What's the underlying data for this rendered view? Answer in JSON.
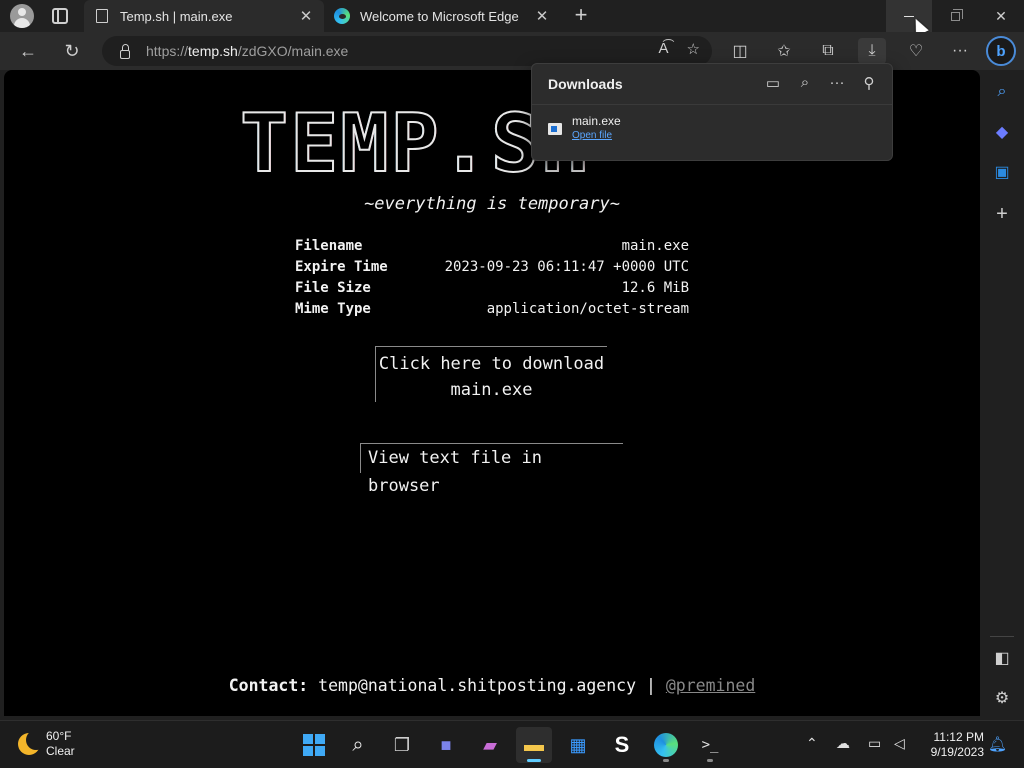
{
  "browser": {
    "tabs": [
      {
        "title": "Temp.sh | main.exe",
        "active": true
      },
      {
        "title": "Welcome to Microsoft Edge",
        "active": false
      }
    ],
    "url": {
      "scheme": "https://",
      "host": "temp.sh",
      "path": "/zdGXO/main.exe"
    },
    "icons": {
      "back": "arrow-left-icon",
      "refresh": "refresh-icon",
      "lock": "lock-icon",
      "read_aloud": "read-aloud-icon",
      "favorite": "star-icon",
      "split": "split-screen-icon",
      "favorites": "favorites-icon",
      "collections": "collections-icon",
      "downloads": "download-icon",
      "health": "browser-essentials-icon",
      "more": "more-icon",
      "copilot": "bing-copilot-icon"
    }
  },
  "page": {
    "logo": "TEMP.SH",
    "tagline": "~everything is temporary~",
    "info": [
      {
        "key": "Filename",
        "value": "main.exe"
      },
      {
        "key": "Expire Time",
        "value": "2023-09-23 06:11:47 +0000 UTC"
      },
      {
        "key": "File Size",
        "value": "12.6 MiB"
      },
      {
        "key": "Mime Type",
        "value": "application/octet-stream"
      }
    ],
    "download_line1": "Click here to download",
    "download_line2": "main.exe",
    "view_text": "View text file in browser",
    "contact_label": "Contact:",
    "contact_email": "temp@national.shitposting.agency",
    "contact_sep": "|",
    "contact_handle": "@premined"
  },
  "downloads_panel": {
    "title": "Downloads",
    "items": [
      {
        "name": "main.exe",
        "action": "Open file"
      }
    ]
  },
  "taskbar": {
    "weather_temp": "60°F",
    "weather_desc": "Clear",
    "time": "11:12 PM",
    "date": "9/19/2023"
  },
  "colors": {
    "accent": "#60cdff",
    "link": "#5aa6ff",
    "background": "#000000"
  }
}
